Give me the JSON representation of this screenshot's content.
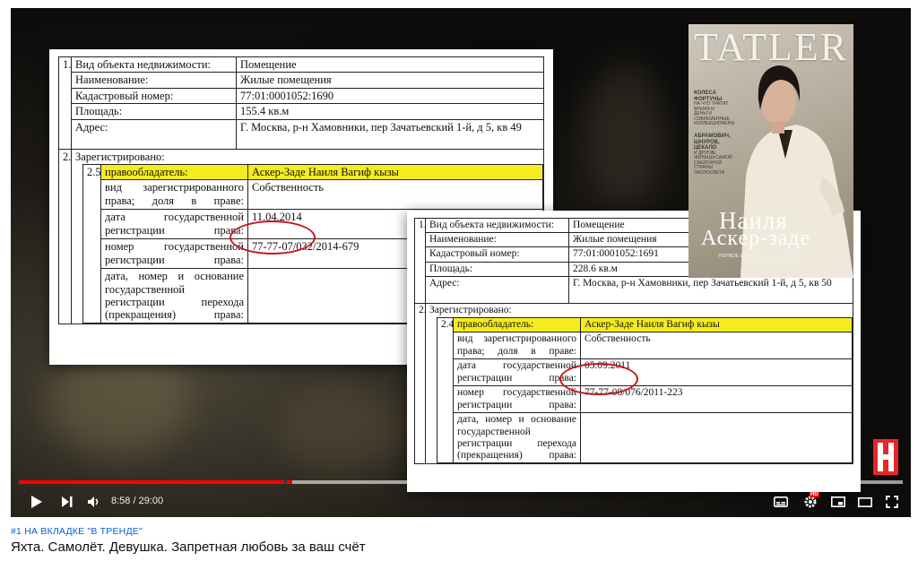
{
  "doc1": {
    "rows": [
      {
        "n": "1.",
        "label": "Вид объекта недвижимости:",
        "value": "Помещение"
      },
      {
        "label": "Наименование:",
        "value": "Жилые помещения"
      },
      {
        "label": "Кадастровый номер:",
        "value": "77:01:0001052:1690"
      },
      {
        "label": "Площадь:",
        "value": "155.4 кв.м"
      },
      {
        "label": "Адрес:",
        "value": "Г. Москва, р-н Хамовники, пер Зачатьевский 1-й, д 5, кв 49"
      }
    ],
    "registered_n": "2.",
    "registered_label": "Зарегистрировано:",
    "sub_n": "2.5",
    "holder_label": "правообладатель:",
    "holder_value": "Аскер-Заде Наиля Вагиф кызы",
    "right_type_label": "вид зарегистрированного права; доля в праве:",
    "right_type_value": "Собственность",
    "date_label": "дата государственной регистрации права:",
    "date_value": "11.04.2014",
    "number_label": "номер государственной регистрации права:",
    "number_value": "77-77-07/032/2014-679",
    "basis_label": "дата, номер и основание государственной регистрации перехода (прекращения) права:"
  },
  "doc2": {
    "rows": [
      {
        "n": "1.",
        "label": "Вид объекта недвижимости:",
        "value": "Помещение"
      },
      {
        "label": "Наименование:",
        "value": "Жилые помещения"
      },
      {
        "label": "Кадастровый номер:",
        "value": "77:01:0001052:1691"
      },
      {
        "label": "Площадь:",
        "value": "228.6 кв.м"
      },
      {
        "label": "Адрес:",
        "value": "Г. Москва, р-н Хамовники, пер Зачатьевский 1-й, д 5, кв 50"
      }
    ],
    "registered_n": "2.",
    "registered_label": "Зарегистрировано:",
    "sub_n": "2.4",
    "holder_label": "правообладатель:",
    "holder_value": "Аскер-Заде Наиля Вагиф кызы",
    "right_type_label": "вид зарегистрированного права; доля в праве:",
    "right_type_value": "Собственность",
    "date_label": "дата государственной регистрации права:",
    "date_value": "05.09.2011",
    "number_label": "номер государственной регистрации права:",
    "number_value": "77-77-08/076/2011-223",
    "basis_label": "дата, номер и основание государственной регистрации перехода (прекращения) права:"
  },
  "magazine": {
    "logo": "TATLER",
    "name_line1": "Наиля",
    "name_line2": "Аскер-заде",
    "subtitle": "ПЕРВОЕ ИНТЕРВЬЮ САМОЙ ОБСУЖДАЕМОЙ ТЕЛЕВЕДУЩЕЙ РОССИИ",
    "side_1": "КОЛЕСА ФОРТУНЫ",
    "side_1_sub": "НА ЧТО ТРАТЯТ ВРЕМЯ И ДЕНЬГИ СОВРЕМЕННЫЕ КОЛЛЕКЦИОНЕРЫ",
    "side_2": "АБРАМОВИЧ, ШНУРОВ, ЦЕКАЛО",
    "side_2_sub": "И ДРУГИЕ ЖИЛЬЦЫ САМОЙ СКАЗОЧНОЙ СТРАНЫ ОКОЛОСВЕТА"
  },
  "player": {
    "time": "8:58 / 29:00",
    "progress_fraction": 0.309,
    "hd_badge": "HD",
    "accent": "#ff0000"
  },
  "video": {
    "trending": "#1 НА ВКЛАДКЕ \"В ТРЕНДЕ\"",
    "title": "Яхта. Самолёт. Девушка. Запретная любовь за ваш счёт"
  }
}
